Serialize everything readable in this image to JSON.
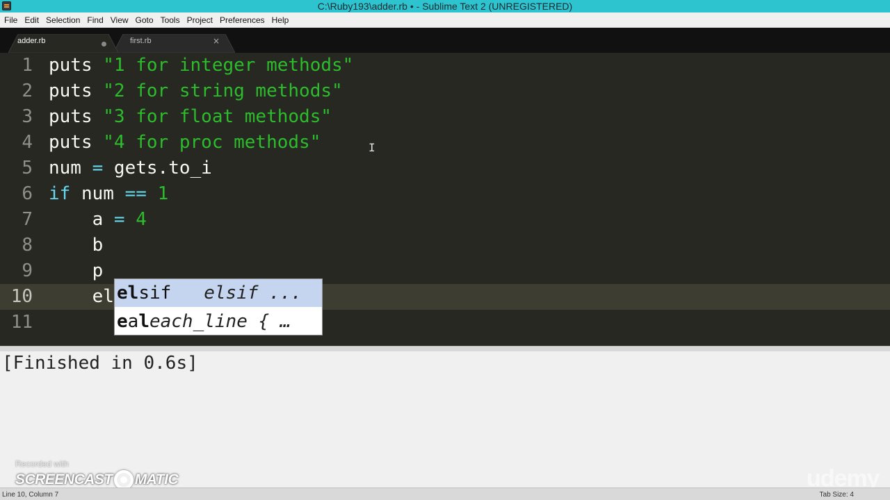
{
  "window": {
    "title": "C:\\Ruby193\\adder.rb • - Sublime Text 2 (UNREGISTERED)",
    "icon": "sublime-text-icon"
  },
  "menubar": {
    "items": [
      "File",
      "Edit",
      "Selection",
      "Find",
      "View",
      "Goto",
      "Tools",
      "Project",
      "Preferences",
      "Help"
    ]
  },
  "tabs": [
    {
      "label": "adder.rb",
      "active": true,
      "dirty": true
    },
    {
      "label": "first.rb",
      "active": false,
      "close_glyph": "×"
    }
  ],
  "editor": {
    "line_numbers": [
      "1",
      "2",
      "3",
      "4",
      "5",
      "6",
      "7",
      "8",
      "9",
      "10",
      "11"
    ],
    "lines": [
      [
        {
          "t": "id",
          "v": "puts "
        },
        {
          "t": "str",
          "v": "\"1 for integer methods\""
        }
      ],
      [
        {
          "t": "id",
          "v": "puts "
        },
        {
          "t": "str",
          "v": "\"2 for string methods\""
        }
      ],
      [
        {
          "t": "id",
          "v": "puts "
        },
        {
          "t": "str",
          "v": "\"3 for float methods\""
        }
      ],
      [
        {
          "t": "id",
          "v": "puts "
        },
        {
          "t": "str",
          "v": "\"4 for proc methods\""
        }
      ],
      [
        {
          "t": "id",
          "v": "num "
        },
        {
          "t": "op",
          "v": "="
        },
        {
          "t": "id",
          "v": " gets.to_i"
        }
      ],
      [
        {
          "t": "kw",
          "v": "if"
        },
        {
          "t": "id",
          "v": " num "
        },
        {
          "t": "op",
          "v": "=="
        },
        {
          "t": "id",
          "v": " "
        },
        {
          "t": "num",
          "v": "1"
        }
      ],
      [
        {
          "t": "id",
          "v": "    a "
        },
        {
          "t": "op",
          "v": "="
        },
        {
          "t": "id",
          "v": " "
        },
        {
          "t": "num",
          "v": "4"
        }
      ],
      [
        {
          "t": "id",
          "v": "    b"
        }
      ],
      [
        {
          "t": "id",
          "v": "    p"
        }
      ],
      [
        {
          "t": "id",
          "v": "    el"
        }
      ],
      []
    ],
    "current_line": "10"
  },
  "autocomplete": {
    "items": [
      {
        "match": "el",
        "rest": "sif",
        "hint": "elsif ...",
        "selected": true
      },
      {
        "match": "e",
        "mid": "a",
        "match2": "l",
        "hint": "each_line { …",
        "selected": false
      }
    ]
  },
  "output": {
    "text": "[Finished in 0.6s]"
  },
  "watermarks": {
    "recorded_with": "Recorded with",
    "screencast_left": "SCREENCAST",
    "screencast_right": "MATIC",
    "udemy": "udemy"
  },
  "statusbar": {
    "position": "Line 10, Column 7",
    "tab_size": "Tab Size: 4"
  }
}
